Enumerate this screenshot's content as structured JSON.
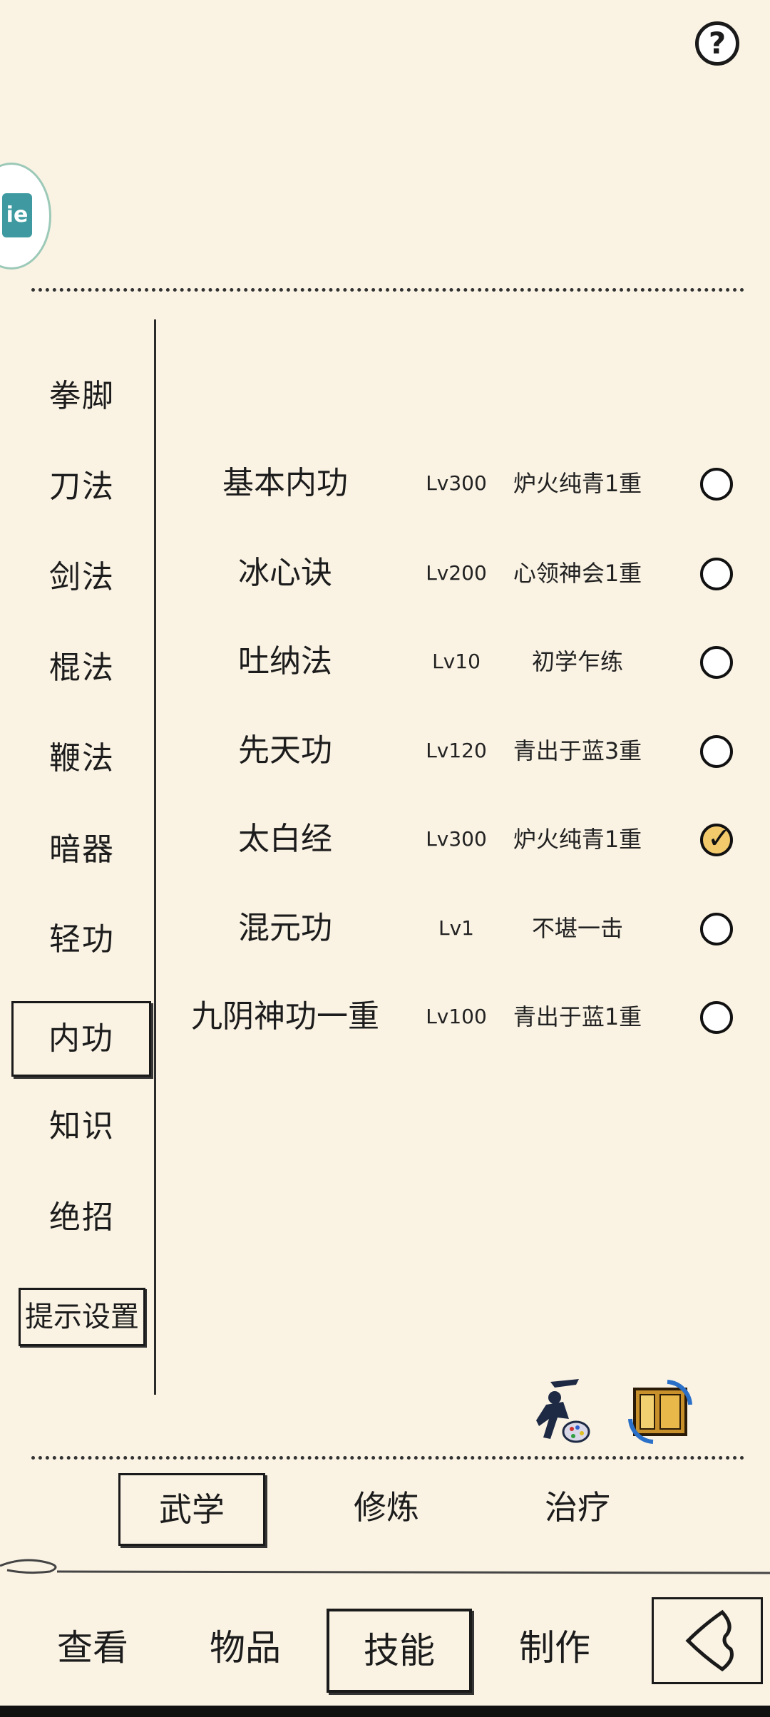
{
  "header": {
    "help_label": "?"
  },
  "avatar": {
    "badge_text": "ie"
  },
  "sidebar": {
    "items": [
      {
        "label": "拳脚"
      },
      {
        "label": "刀法"
      },
      {
        "label": "剑法"
      },
      {
        "label": "棍法"
      },
      {
        "label": "鞭法"
      },
      {
        "label": "暗器"
      },
      {
        "label": "轻功"
      },
      {
        "label": "内功",
        "active": true
      },
      {
        "label": "知识"
      },
      {
        "label": "绝招"
      }
    ],
    "hint_settings_label": "提示设置"
  },
  "skills": [
    {
      "name": "基本内功",
      "level": "Lv300",
      "rank": "炉火纯青1重",
      "checked": false
    },
    {
      "name": "冰心诀",
      "level": "Lv200",
      "rank": "心领神会1重",
      "checked": false
    },
    {
      "name": "吐纳法",
      "level": "Lv10",
      "rank": "初学乍练",
      "checked": false
    },
    {
      "name": "先天功",
      "level": "Lv120",
      "rank": "青出于蓝3重",
      "checked": false
    },
    {
      "name": "太白经",
      "level": "Lv300",
      "rank": "炉火纯青1重",
      "checked": true
    },
    {
      "name": "混元功",
      "level": "Lv1",
      "rank": "不堪一击",
      "checked": false
    },
    {
      "name": "九阴神功一重",
      "level": "Lv100",
      "rank": "青出于蓝1重",
      "checked": false
    }
  ],
  "tools": {
    "left_icon": "swordsman-palette-icon",
    "right_icon": "swap-scroll-icon"
  },
  "sub_tabs": [
    {
      "label": "武学",
      "active": true
    },
    {
      "label": "修炼",
      "active": false
    },
    {
      "label": "治疗",
      "active": false
    }
  ],
  "bottom_nav": [
    {
      "label": "查看",
      "active": false
    },
    {
      "label": "物品",
      "active": false
    },
    {
      "label": "技能",
      "active": true
    },
    {
      "label": "制作",
      "active": false
    }
  ],
  "colors": {
    "background": "#faf3e4",
    "check_fill": "#f2c96b",
    "avatar_badge": "#3e9aa0"
  }
}
